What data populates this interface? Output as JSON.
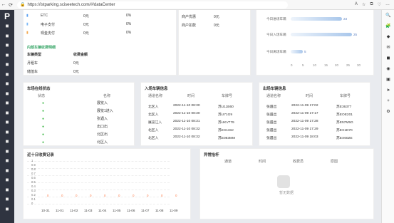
{
  "browser": {
    "url": "https://istparking.sciseetech.com/#/dataCenter",
    "icons": [
      "←",
      "⟳",
      "🔒",
      "A",
      "☆",
      "⧉",
      "♡",
      "…"
    ]
  },
  "sidebar": {
    "logo": "P",
    "items": [
      "◼",
      "◼",
      "◼",
      "◼",
      "◼",
      "◼",
      "◼",
      "◼",
      "◼",
      "◼",
      "◼",
      "◼",
      "◼",
      "◼",
      "◼",
      "◼",
      "◼",
      "◼",
      "◼",
      "◼"
    ]
  },
  "top_left": {
    "payments": [
      {
        "icon": "▮",
        "name": "ETC",
        "amount": "0元",
        "percent": "0%"
      },
      {
        "icon": "▮",
        "name": "电子支付",
        "amount": "0元",
        "percent": "0%"
      },
      {
        "icon": "▮",
        "name": "现金支付",
        "amount": "0元",
        "percent": "0%"
      }
    ],
    "internal_title": "内部车辆收费明细",
    "internal_headers": [
      "车辆类型",
      "收费金额"
    ],
    "internal_rows": [
      [
        "月租车",
        "0元"
      ],
      [
        "储值车",
        "0元"
      ]
    ]
  },
  "top_middle": {
    "rows": [
      [
        "商户优惠",
        "0元"
      ],
      [
        "商户扣款",
        "0元"
      ]
    ]
  },
  "top_right": {
    "bars": [
      {
        "label": "今日进场车辆",
        "value": 23
      },
      {
        "label": "今日入场车辆",
        "value": 25
      },
      {
        "label": "今日离场车辆",
        "value": 5
      }
    ],
    "ticks": [
      "0",
      "5",
      "10",
      "15",
      "20",
      "25",
      "30"
    ]
  },
  "onsite": {
    "title": "车场在线状态",
    "headers": [
      "状态",
      "名称"
    ],
    "rows": [
      "展览入",
      "展览1进入",
      "张遇入",
      "出口出",
      "北区出",
      "北区入",
      "南区出"
    ]
  },
  "entry": {
    "title": "入场车辆信息",
    "headers": [
      "通道名称",
      "时间",
      "车牌号"
    ],
    "rows": [
      [
        "北区入",
        "2022-11-10 08:30",
        "苏U11B60"
      ],
      [
        "北区入",
        "2022-11-10 08:30",
        "苏U71G9"
      ],
      [
        "展览江入",
        "2022-11-10 08:31",
        "苏UKV779"
      ],
      [
        "北区入",
        "2022-11-10 08:32",
        "苏EX133J"
      ],
      [
        "北区入",
        "2022-11-10 08:32",
        "苏E083MM"
      ]
    ]
  },
  "exit": {
    "title": "出场车辆信息",
    "headers": [
      "通道名称",
      "时间",
      "车牌号"
    ],
    "rows": [
      [
        "张遇出",
        "2022-11-09 17:02",
        "苏E36377"
      ],
      [
        "张遇出",
        "2022-11-09 17:17",
        "苏EOE201"
      ],
      [
        "张遇出",
        "2022-11-09 17:28",
        "苏E57M5G"
      ],
      [
        "张遇出",
        "2022-11-09 17:29",
        "苏EX1D70"
      ],
      [
        "张遇出",
        "2022-11-09 18:03",
        "苏EX60ZE"
      ]
    ]
  },
  "revenue": {
    "title": "近十日收费记录",
    "y_ticks": [
      "1",
      "0.9",
      "0.8",
      "0.7",
      "0.6",
      "0.5",
      "0.4",
      "0.3",
      "0.2",
      "0.1",
      "0"
    ],
    "chart_data": {
      "type": "line",
      "x": [
        "10-31",
        "11-01",
        "11-02",
        "11-03",
        "11-04",
        "11-05",
        "11-06",
        "11-07",
        "11-08",
        "11-09"
      ],
      "values": [
        0,
        0,
        0,
        0,
        0,
        0,
        0,
        0,
        0,
        0
      ],
      "ylim": [
        0,
        1
      ]
    }
  },
  "abnormal": {
    "title": "异常抬杆",
    "headers": [
      "通道",
      "时间",
      "收费员",
      "原因"
    ],
    "empty": "暂无数据"
  },
  "extensions": [
    "🔍",
    "🧩",
    "◆",
    "✉",
    "◼",
    "◉",
    "▣",
    "➤",
    "+",
    "⚙"
  ]
}
